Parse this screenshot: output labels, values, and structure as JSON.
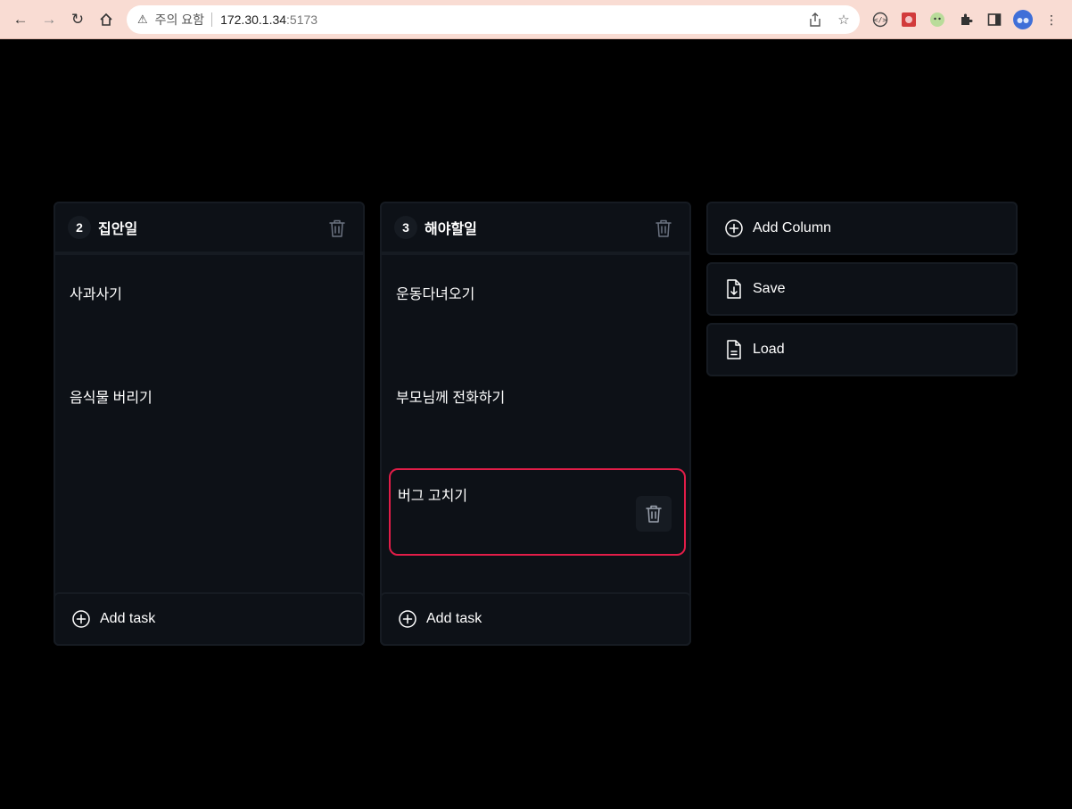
{
  "browser": {
    "security_warning": "주의 요함",
    "url_host": "172.30.1.34",
    "url_port": ":5173"
  },
  "columns": [
    {
      "count": "2",
      "title": "집안일",
      "tasks": [
        "사과사기",
        "음식물 버리기"
      ],
      "add_task_label": "Add task"
    },
    {
      "count": "3",
      "title": "해야할일",
      "tasks": [
        "운동다녀오기",
        "부모님께 전화하기",
        "버그 고치기"
      ],
      "add_task_label": "Add task"
    }
  ],
  "actions": {
    "add_column_label": "Add Column",
    "save_label": "Save",
    "load_label": "Load"
  },
  "colors": {
    "background": "#000000",
    "column_bg": "#0d1117",
    "column_border": "#161b22",
    "active_task_border": "#e11d48",
    "chrome_bg": "#f9dcd3"
  }
}
